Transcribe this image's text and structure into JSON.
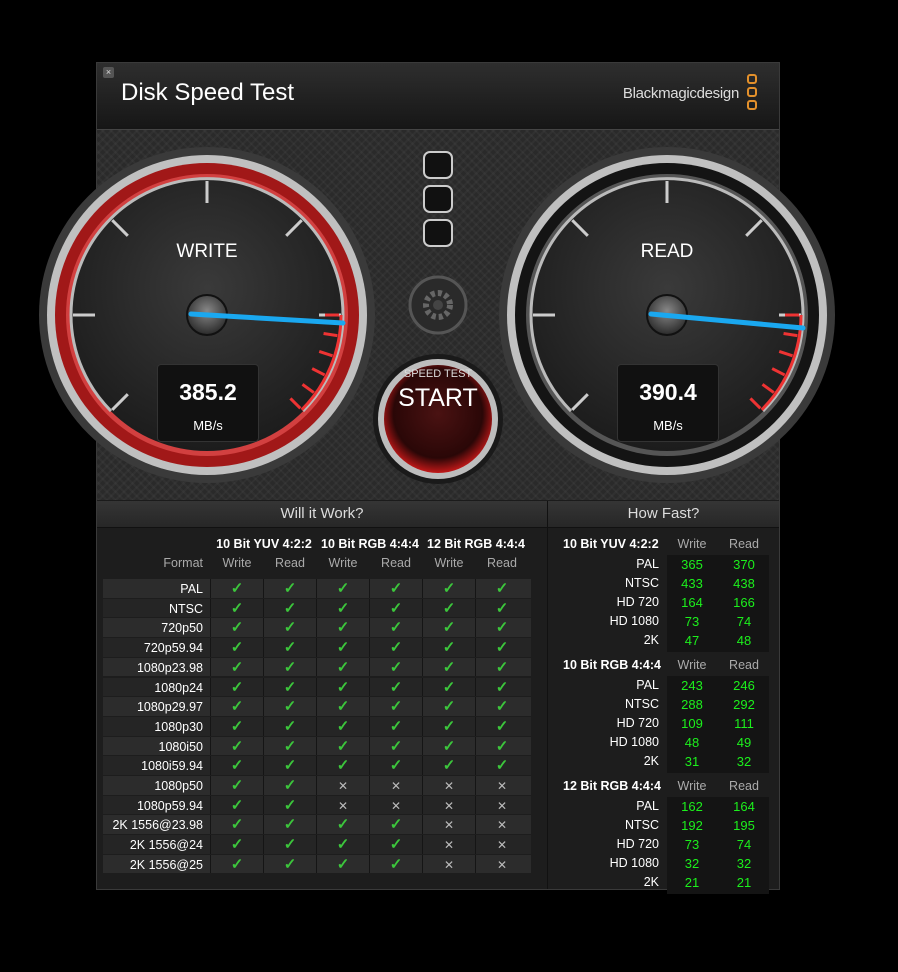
{
  "window": {
    "title": "Disk Speed Test",
    "brand": "Blackmagicdesign",
    "close_glyph": "×"
  },
  "gauges": {
    "write": {
      "label": "WRITE",
      "value": "385.2",
      "unit": "MB/s"
    },
    "read": {
      "label": "READ",
      "value": "390.4",
      "unit": "MB/s"
    },
    "needle_color": "#1aa8f0",
    "write_ring_color": "#b22222"
  },
  "start_button": {
    "sub_label": "SPEED TEST",
    "label": "START"
  },
  "settings_icon": "gear-icon",
  "will_it_work": {
    "title": "Will it Work?",
    "format_header": "Format",
    "groups": [
      "10 Bit YUV 4:2:2",
      "10 Bit RGB 4:4:4",
      "12 Bit RGB 4:4:4"
    ],
    "subcols": [
      "Write",
      "Read",
      "Write",
      "Read",
      "Write",
      "Read"
    ],
    "check_glyph": "✓",
    "cross_glyph": "✕",
    "rows": [
      {
        "format": "PAL",
        "cells": [
          1,
          1,
          1,
          1,
          1,
          1
        ]
      },
      {
        "format": "NTSC",
        "cells": [
          1,
          1,
          1,
          1,
          1,
          1
        ]
      },
      {
        "format": "720p50",
        "cells": [
          1,
          1,
          1,
          1,
          1,
          1
        ]
      },
      {
        "format": "720p59.94",
        "cells": [
          1,
          1,
          1,
          1,
          1,
          1
        ]
      },
      {
        "format": "1080p23.98",
        "cells": [
          1,
          1,
          1,
          1,
          1,
          1
        ]
      },
      {
        "format": "1080p24",
        "cells": [
          1,
          1,
          1,
          1,
          1,
          1
        ]
      },
      {
        "format": "1080p29.97",
        "cells": [
          1,
          1,
          1,
          1,
          1,
          1
        ]
      },
      {
        "format": "1080p30",
        "cells": [
          1,
          1,
          1,
          1,
          1,
          1
        ]
      },
      {
        "format": "1080i50",
        "cells": [
          1,
          1,
          1,
          1,
          1,
          1
        ]
      },
      {
        "format": "1080i59.94",
        "cells": [
          1,
          1,
          1,
          1,
          1,
          1
        ]
      },
      {
        "format": "1080p50",
        "cells": [
          1,
          1,
          0,
          0,
          0,
          0
        ]
      },
      {
        "format": "1080p59.94",
        "cells": [
          1,
          1,
          0,
          0,
          0,
          0
        ]
      },
      {
        "format": "2K 1556@23.98",
        "cells": [
          1,
          1,
          1,
          1,
          0,
          0
        ]
      },
      {
        "format": "2K 1556@24",
        "cells": [
          1,
          1,
          1,
          1,
          0,
          0
        ]
      },
      {
        "format": "2K 1556@25",
        "cells": [
          1,
          1,
          1,
          1,
          0,
          0
        ]
      }
    ]
  },
  "how_fast": {
    "title": "How Fast?",
    "write_header": "Write",
    "read_header": "Read",
    "groups": [
      {
        "name": "10 Bit YUV 4:2:2",
        "rows": [
          {
            "format": "PAL",
            "write": "365",
            "read": "370"
          },
          {
            "format": "NTSC",
            "write": "433",
            "read": "438"
          },
          {
            "format": "HD 720",
            "write": "164",
            "read": "166"
          },
          {
            "format": "HD 1080",
            "write": "73",
            "read": "74"
          },
          {
            "format": "2K",
            "write": "47",
            "read": "48"
          }
        ]
      },
      {
        "name": "10 Bit RGB 4:4:4",
        "rows": [
          {
            "format": "PAL",
            "write": "243",
            "read": "246"
          },
          {
            "format": "NTSC",
            "write": "288",
            "read": "292"
          },
          {
            "format": "HD 720",
            "write": "109",
            "read": "111"
          },
          {
            "format": "HD 1080",
            "write": "48",
            "read": "49"
          },
          {
            "format": "2K",
            "write": "31",
            "read": "32"
          }
        ]
      },
      {
        "name": "12 Bit RGB 4:4:4",
        "rows": [
          {
            "format": "PAL",
            "write": "162",
            "read": "164"
          },
          {
            "format": "NTSC",
            "write": "192",
            "read": "195"
          },
          {
            "format": "HD 720",
            "write": "73",
            "read": "74"
          },
          {
            "format": "HD 1080",
            "write": "32",
            "read": "32"
          },
          {
            "format": "2K",
            "write": "21",
            "read": "21"
          }
        ]
      }
    ]
  }
}
